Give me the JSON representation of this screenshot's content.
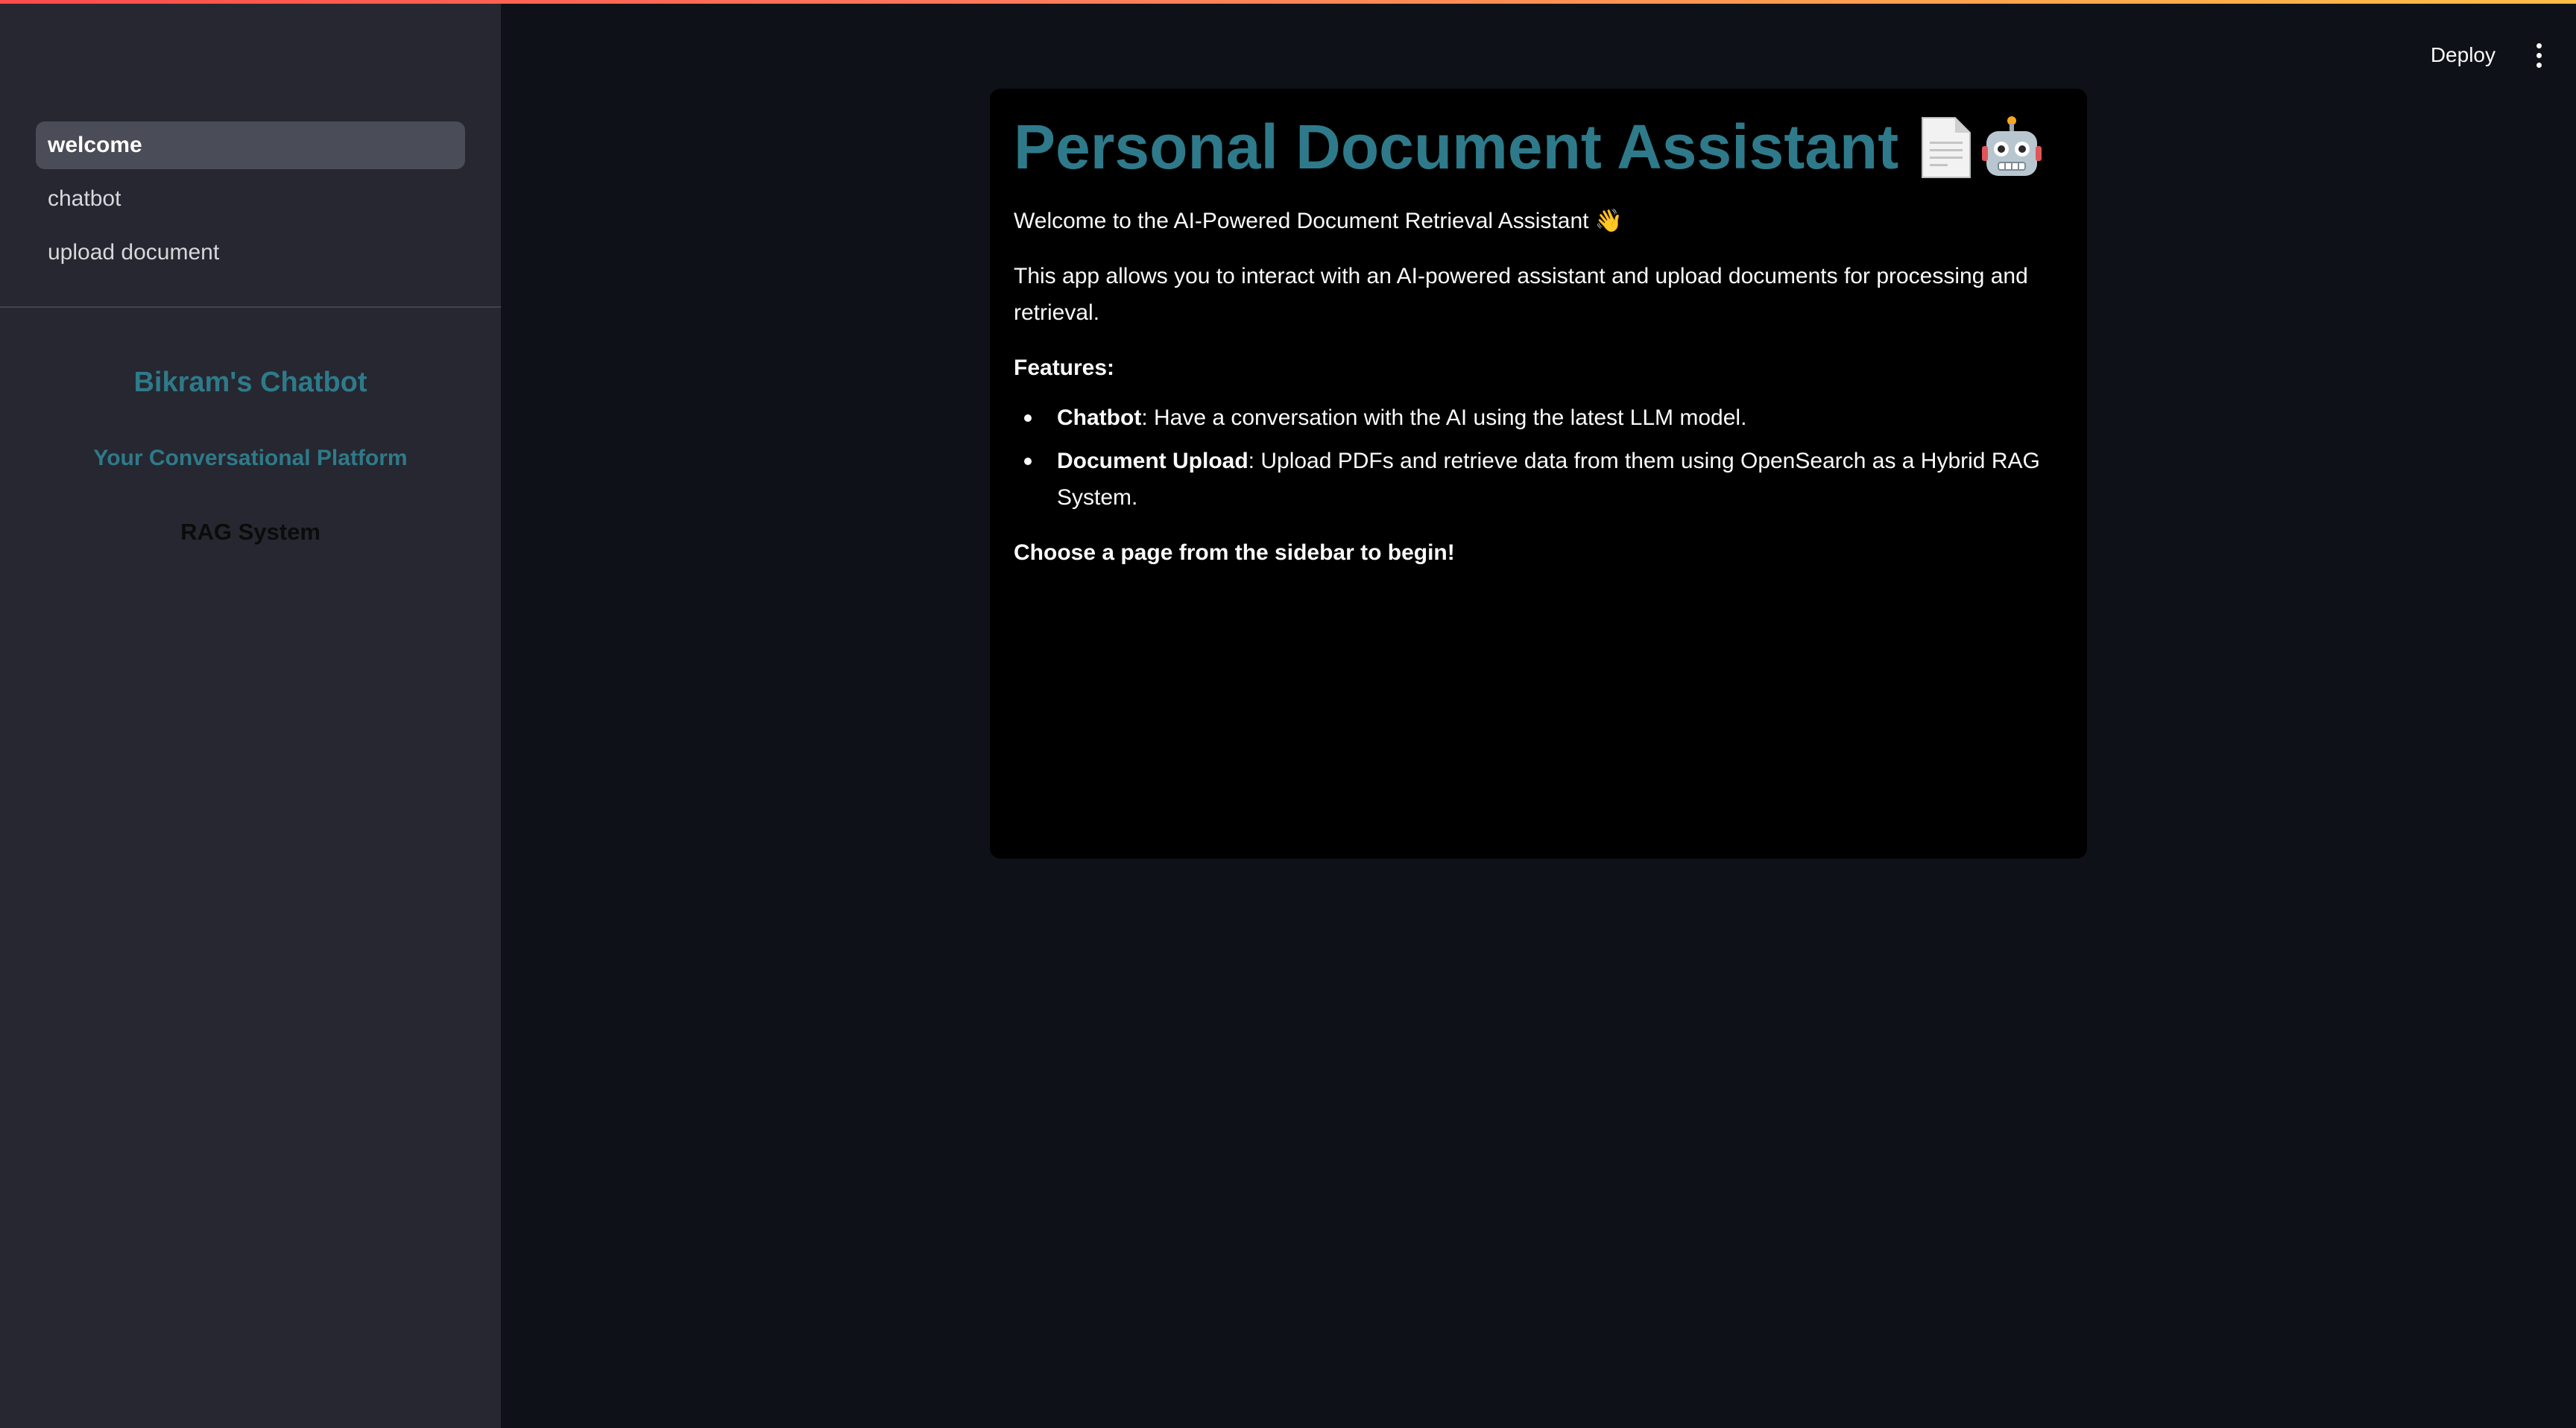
{
  "sidebar": {
    "nav": [
      {
        "label": "welcome",
        "active": true
      },
      {
        "label": "chatbot",
        "active": false
      },
      {
        "label": "upload document",
        "active": false
      }
    ],
    "brand_title": "Bikram's Chatbot",
    "brand_subtitle": "Your Conversational Platform",
    "brand_system": "RAG System"
  },
  "header": {
    "deploy_label": "Deploy",
    "menu_icon": "kebab-menu-icon"
  },
  "main": {
    "title": "Personal Document Assistant",
    "title_icons": [
      "page-document-icon",
      "robot-icon"
    ],
    "welcome_text": "Welcome to the AI-Powered Document Retrieval Assistant",
    "wave_emoji": "👋",
    "description": "This app allows you to interact with an AI-powered assistant and upload documents for processing and retrieval.",
    "features_label": "Features:",
    "features": [
      {
        "name": "Chatbot",
        "text": ": Have a conversation with the AI using the latest LLM model."
      },
      {
        "name": "Document Upload",
        "text": ": Upload PDFs and retrieve data from them using OpenSearch as a Hybrid RAG System."
      }
    ],
    "cta": "Choose a page from the sidebar to begin!"
  },
  "colors": {
    "accent_teal": "#2e7a8a",
    "background": "#0e1117",
    "sidebar": "#262730",
    "card": "#000000"
  }
}
